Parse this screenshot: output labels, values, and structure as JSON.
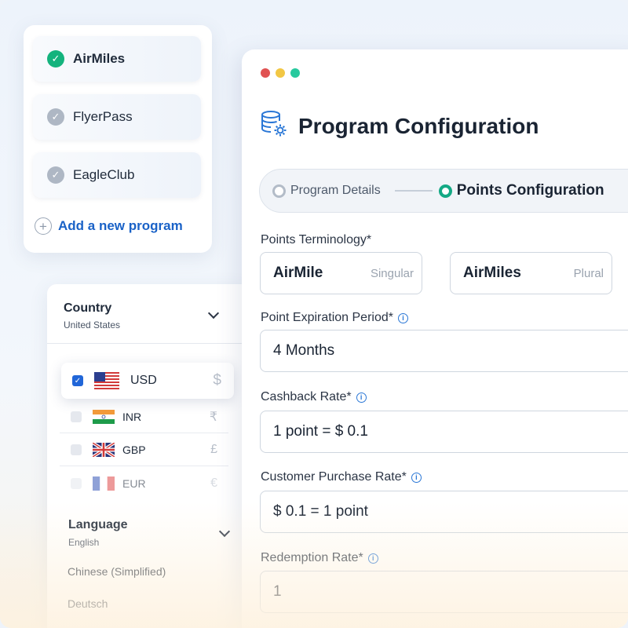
{
  "window_dots": [
    "#e05252",
    "#f2c744",
    "#27c99e"
  ],
  "programs": {
    "items": [
      {
        "name": "AirMiles",
        "selected": true
      },
      {
        "name": "FlyerPass",
        "selected": false
      },
      {
        "name": "EagleClub",
        "selected": false
      }
    ],
    "add_label": "Add a new program"
  },
  "country": {
    "title": "Country",
    "value": "United States",
    "currencies": [
      {
        "code": "USD",
        "symbol": "$",
        "checked": true,
        "flag": "us-flag"
      },
      {
        "code": "INR",
        "symbol": "₹",
        "checked": false,
        "flag": "india-flag"
      },
      {
        "code": "GBP",
        "symbol": "£",
        "checked": false,
        "flag": "uk-flag"
      },
      {
        "code": "EUR",
        "symbol": "€",
        "checked": false,
        "flag": "france-flag"
      }
    ]
  },
  "language": {
    "title": "Language",
    "value": "English",
    "options": [
      "Chinese (Simplified)",
      "Deutsch"
    ]
  },
  "config": {
    "title": "Program Configuration",
    "steps": [
      {
        "label": "Program Details",
        "active": false
      },
      {
        "label": "Points Configuration",
        "active": true
      }
    ],
    "terminology": {
      "label": "Points Terminology*",
      "singular_value": "AirMile",
      "singular_hint": "Singular",
      "plural_value": "AirMiles",
      "plural_hint": "Plural"
    },
    "expiration": {
      "label": "Point Expiration Period*",
      "value": "4 Months"
    },
    "cashback": {
      "label": "Cashback Rate*",
      "value": "1 point = $ 0.1"
    },
    "purchase": {
      "label": "Customer Purchase Rate*",
      "value": "$ 0.1 = 1 point"
    },
    "redemption": {
      "label": "Redemption Rate*",
      "value": "1"
    }
  }
}
